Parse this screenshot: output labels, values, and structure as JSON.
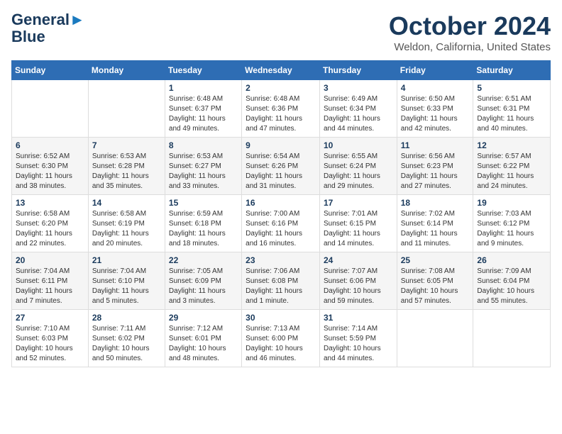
{
  "header": {
    "logo_line1": "General",
    "logo_line2": "Blue",
    "month_title": "October 2024",
    "location": "Weldon, California, United States"
  },
  "days_of_week": [
    "Sunday",
    "Monday",
    "Tuesday",
    "Wednesday",
    "Thursday",
    "Friday",
    "Saturday"
  ],
  "weeks": [
    [
      {
        "day": "",
        "info": ""
      },
      {
        "day": "",
        "info": ""
      },
      {
        "day": "1",
        "info": "Sunrise: 6:48 AM\nSunset: 6:37 PM\nDaylight: 11 hours and 49 minutes."
      },
      {
        "day": "2",
        "info": "Sunrise: 6:48 AM\nSunset: 6:36 PM\nDaylight: 11 hours and 47 minutes."
      },
      {
        "day": "3",
        "info": "Sunrise: 6:49 AM\nSunset: 6:34 PM\nDaylight: 11 hours and 44 minutes."
      },
      {
        "day": "4",
        "info": "Sunrise: 6:50 AM\nSunset: 6:33 PM\nDaylight: 11 hours and 42 minutes."
      },
      {
        "day": "5",
        "info": "Sunrise: 6:51 AM\nSunset: 6:31 PM\nDaylight: 11 hours and 40 minutes."
      }
    ],
    [
      {
        "day": "6",
        "info": "Sunrise: 6:52 AM\nSunset: 6:30 PM\nDaylight: 11 hours and 38 minutes."
      },
      {
        "day": "7",
        "info": "Sunrise: 6:53 AM\nSunset: 6:28 PM\nDaylight: 11 hours and 35 minutes."
      },
      {
        "day": "8",
        "info": "Sunrise: 6:53 AM\nSunset: 6:27 PM\nDaylight: 11 hours and 33 minutes."
      },
      {
        "day": "9",
        "info": "Sunrise: 6:54 AM\nSunset: 6:26 PM\nDaylight: 11 hours and 31 minutes."
      },
      {
        "day": "10",
        "info": "Sunrise: 6:55 AM\nSunset: 6:24 PM\nDaylight: 11 hours and 29 minutes."
      },
      {
        "day": "11",
        "info": "Sunrise: 6:56 AM\nSunset: 6:23 PM\nDaylight: 11 hours and 27 minutes."
      },
      {
        "day": "12",
        "info": "Sunrise: 6:57 AM\nSunset: 6:22 PM\nDaylight: 11 hours and 24 minutes."
      }
    ],
    [
      {
        "day": "13",
        "info": "Sunrise: 6:58 AM\nSunset: 6:20 PM\nDaylight: 11 hours and 22 minutes."
      },
      {
        "day": "14",
        "info": "Sunrise: 6:58 AM\nSunset: 6:19 PM\nDaylight: 11 hours and 20 minutes."
      },
      {
        "day": "15",
        "info": "Sunrise: 6:59 AM\nSunset: 6:18 PM\nDaylight: 11 hours and 18 minutes."
      },
      {
        "day": "16",
        "info": "Sunrise: 7:00 AM\nSunset: 6:16 PM\nDaylight: 11 hours and 16 minutes."
      },
      {
        "day": "17",
        "info": "Sunrise: 7:01 AM\nSunset: 6:15 PM\nDaylight: 11 hours and 14 minutes."
      },
      {
        "day": "18",
        "info": "Sunrise: 7:02 AM\nSunset: 6:14 PM\nDaylight: 11 hours and 11 minutes."
      },
      {
        "day": "19",
        "info": "Sunrise: 7:03 AM\nSunset: 6:12 PM\nDaylight: 11 hours and 9 minutes."
      }
    ],
    [
      {
        "day": "20",
        "info": "Sunrise: 7:04 AM\nSunset: 6:11 PM\nDaylight: 11 hours and 7 minutes."
      },
      {
        "day": "21",
        "info": "Sunrise: 7:04 AM\nSunset: 6:10 PM\nDaylight: 11 hours and 5 minutes."
      },
      {
        "day": "22",
        "info": "Sunrise: 7:05 AM\nSunset: 6:09 PM\nDaylight: 11 hours and 3 minutes."
      },
      {
        "day": "23",
        "info": "Sunrise: 7:06 AM\nSunset: 6:08 PM\nDaylight: 11 hours and 1 minute."
      },
      {
        "day": "24",
        "info": "Sunrise: 7:07 AM\nSunset: 6:06 PM\nDaylight: 10 hours and 59 minutes."
      },
      {
        "day": "25",
        "info": "Sunrise: 7:08 AM\nSunset: 6:05 PM\nDaylight: 10 hours and 57 minutes."
      },
      {
        "day": "26",
        "info": "Sunrise: 7:09 AM\nSunset: 6:04 PM\nDaylight: 10 hours and 55 minutes."
      }
    ],
    [
      {
        "day": "27",
        "info": "Sunrise: 7:10 AM\nSunset: 6:03 PM\nDaylight: 10 hours and 52 minutes."
      },
      {
        "day": "28",
        "info": "Sunrise: 7:11 AM\nSunset: 6:02 PM\nDaylight: 10 hours and 50 minutes."
      },
      {
        "day": "29",
        "info": "Sunrise: 7:12 AM\nSunset: 6:01 PM\nDaylight: 10 hours and 48 minutes."
      },
      {
        "day": "30",
        "info": "Sunrise: 7:13 AM\nSunset: 6:00 PM\nDaylight: 10 hours and 46 minutes."
      },
      {
        "day": "31",
        "info": "Sunrise: 7:14 AM\nSunset: 5:59 PM\nDaylight: 10 hours and 44 minutes."
      },
      {
        "day": "",
        "info": ""
      },
      {
        "day": "",
        "info": ""
      }
    ]
  ]
}
